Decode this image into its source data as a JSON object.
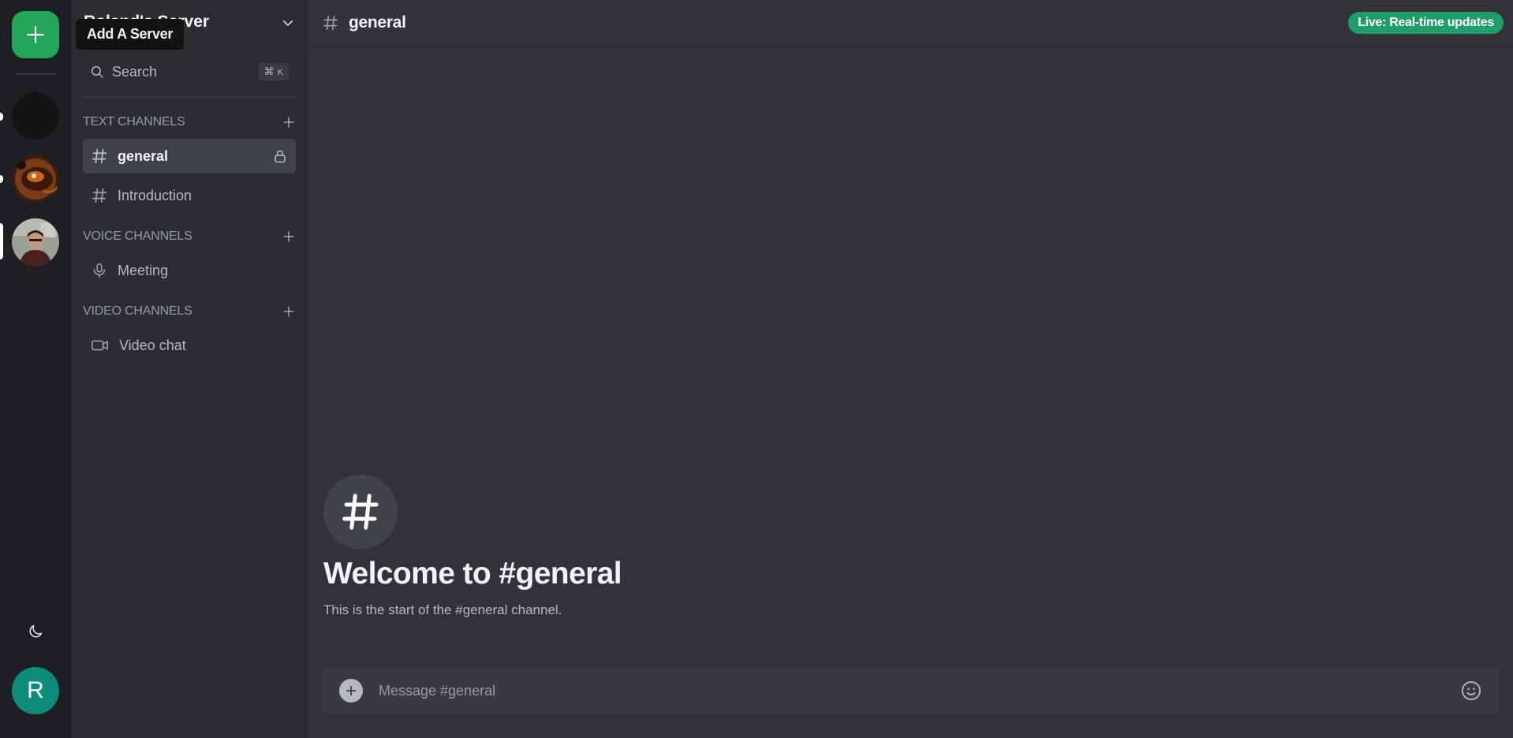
{
  "rail": {
    "add_server_tooltip": "Add A Server",
    "servers": [
      {
        "name": "dark-server",
        "color": "#141414"
      },
      {
        "name": "food-server",
        "color": "#6b3a1e"
      },
      {
        "name": "profile-server",
        "color": "#9aa096"
      }
    ],
    "user_initial": "R",
    "accent": "#23a55a"
  },
  "sidebar": {
    "server_name": "Roland's Server",
    "search_label": "Search",
    "search_shortcut_symbol": "⌘",
    "search_shortcut_key": "K",
    "sections": {
      "text": {
        "title": "Text Channels",
        "channels": [
          "general",
          "Introduction"
        ]
      },
      "voice": {
        "title": "Voice Channels",
        "channels": [
          "Meeting"
        ]
      },
      "video": {
        "title": "Video Channels",
        "channels": [
          "Video chat"
        ]
      }
    }
  },
  "main": {
    "channel_name": "general",
    "live_badge": "Live: Real-time updates",
    "live_badge_color": "#1f9d6b",
    "welcome_title": "Welcome to #general",
    "welcome_subtitle": "This is the start of the #general channel.",
    "composer_placeholder": "Message #general"
  }
}
